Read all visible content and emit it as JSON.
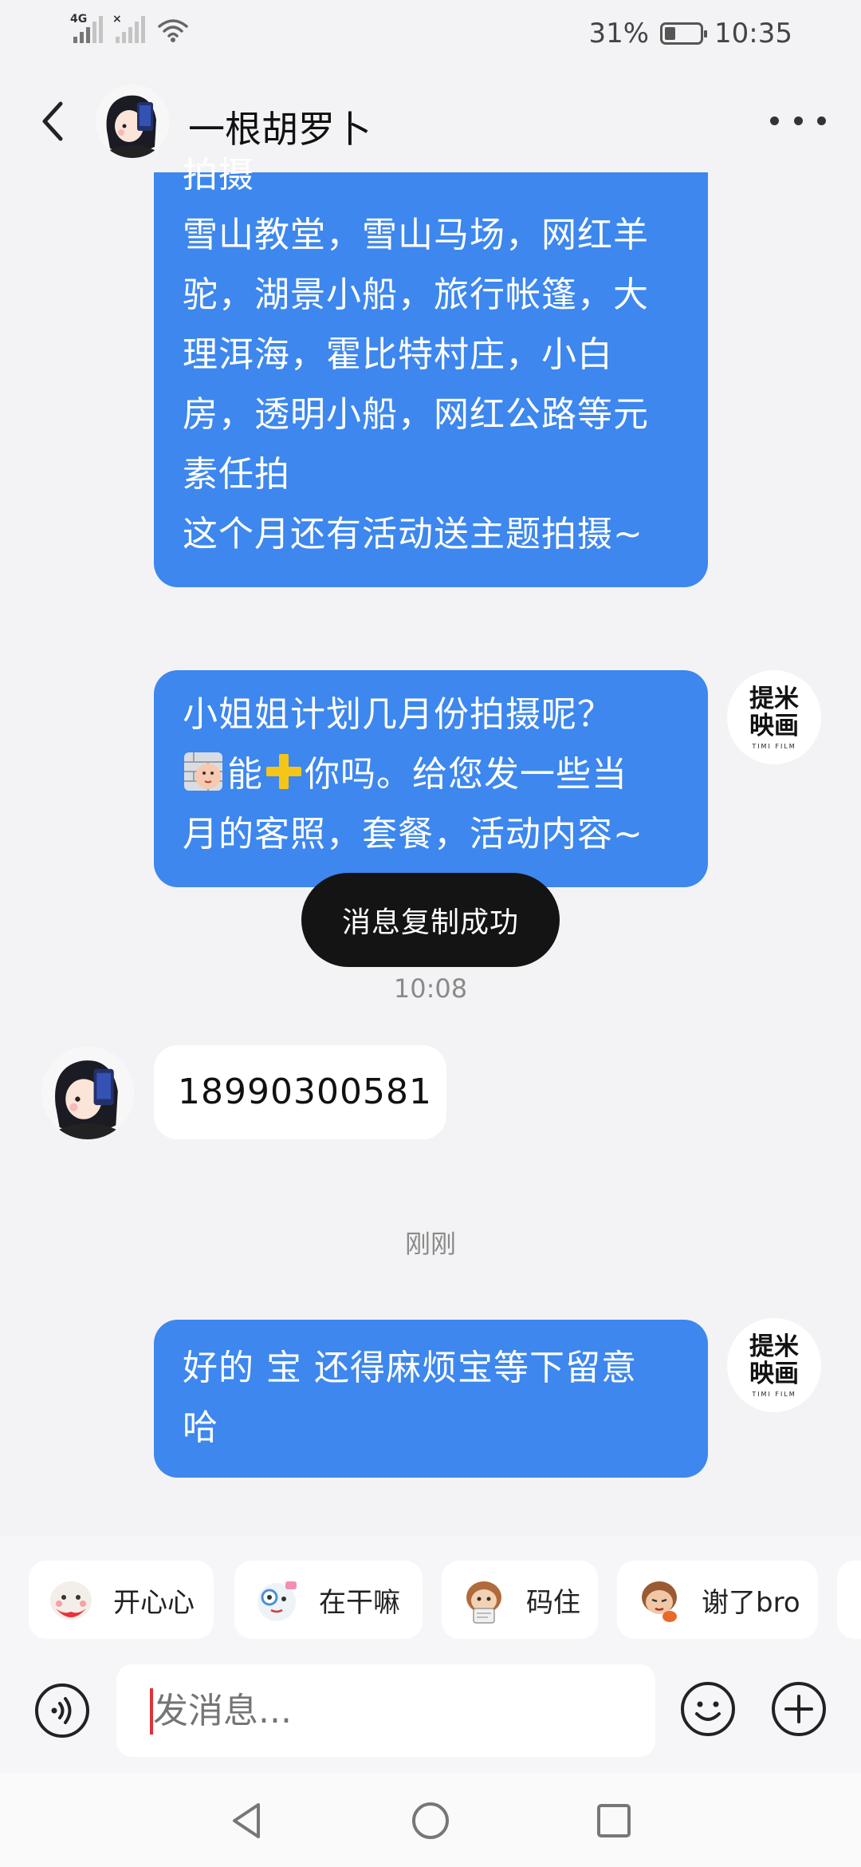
{
  "status_bar": {
    "network_1": "4G",
    "network_2": "×",
    "battery_percent": "31%",
    "battery_level": 0.31,
    "time": "10:35"
  },
  "header": {
    "back_icon": "chevron-left-icon",
    "title": "一根胡罗卜",
    "more_icon": "more-horizontal-icon"
  },
  "messages": [
    {
      "direction": "out",
      "lines": [
        "拍摄",
        "雪山教堂，雪山马场，网红羊",
        "驼，湖景小船，旅行帐篷，大",
        "理洱海，霍比特村庄，小白",
        "房，透明小船，网红公路等元",
        "素任拍",
        "这个月还有活动送主题拍摄~"
      ]
    },
    {
      "direction": "out",
      "line1": "小姐姐计划几月份拍摄呢？",
      "line2_a": "能",
      "line2_b": "你吗。给您发一些当",
      "line3": "月的客照，套餐，活动内容~"
    },
    {
      "direction": "in",
      "text": "18990300581"
    },
    {
      "direction": "out",
      "lines": [
        "好的 宝 还得麻烦宝等下留意",
        "哈"
      ]
    }
  ],
  "shop_avatar": {
    "line1": "提米",
    "line2": "映画",
    "sub": "TIMI FILM"
  },
  "toast": "消息复制成功",
  "timestamps": [
    "10:08",
    "刚刚"
  ],
  "quick_replies": [
    {
      "label": "开心心",
      "icon": "happy-sticker-icon"
    },
    {
      "label": "在干嘛",
      "icon": "what-doing-sticker-icon"
    },
    {
      "label": "码住",
      "icon": "bookmark-sticker-icon"
    },
    {
      "label": "谢了bro",
      "icon": "thanks-sticker-icon"
    },
    {
      "label": "",
      "icon": "sticker-icon"
    }
  ],
  "input": {
    "placeholder": "发消息..."
  },
  "colors": {
    "outgoing_bubble": "#3d87ee",
    "incoming_bubble": "#ffffff",
    "background": "#f3f3f5",
    "toast": "#141414",
    "caret": "#e0313a"
  }
}
